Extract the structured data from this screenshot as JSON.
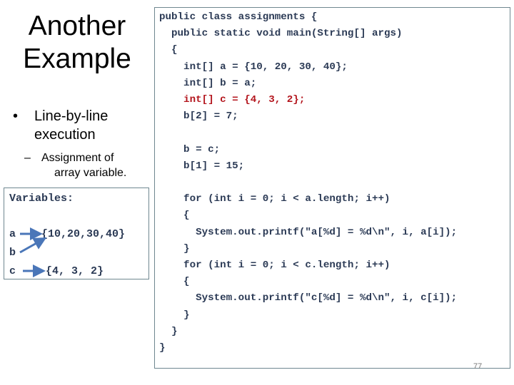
{
  "slide": {
    "title": "Another Example",
    "title_lines": [
      "Another",
      "Example"
    ],
    "bullet": "Line-by-line execution",
    "bullet_glyph": "•",
    "sub_bullet_lines": [
      "Assignment of",
      "array variable."
    ],
    "sub_bullet_glyph": "–",
    "page_number": "77"
  },
  "variables": {
    "heading": "Variables:",
    "rows": [
      {
        "name": "a",
        "value": "{10,20,30,40}"
      },
      {
        "name": "b",
        "value": ""
      },
      {
        "name": "c",
        "value": "{4, 3, 2}"
      }
    ],
    "arrow_color": "#4a76b8",
    "arrow_icon": "arrow-right-icon"
  },
  "code": {
    "highlight_color": "#b3141c",
    "text_color": "#2b3a55",
    "lines": [
      {
        "text": "public class assignments {",
        "highlight": false
      },
      {
        "text": "  public static void main(String[] args)",
        "highlight": false
      },
      {
        "text": "  {",
        "highlight": false
      },
      {
        "text": "    int[] a = {10, 20, 30, 40};",
        "highlight": false
      },
      {
        "text": "    int[] b = a;",
        "highlight": false
      },
      {
        "text": "    int[] c = {4, 3, 2};",
        "highlight": true
      },
      {
        "text": "    b[2] = 7;",
        "highlight": false
      },
      {
        "text": "",
        "highlight": false
      },
      {
        "text": "    b = c;",
        "highlight": false
      },
      {
        "text": "    b[1] = 15;",
        "highlight": false
      },
      {
        "text": "",
        "highlight": false
      },
      {
        "text": "    for (int i = 0; i < a.length; i++)",
        "highlight": false
      },
      {
        "text": "    {",
        "highlight": false
      },
      {
        "text": "      System.out.printf(\"a[%d] = %d\\n\", i, a[i]);",
        "highlight": false
      },
      {
        "text": "    }",
        "highlight": false
      },
      {
        "text": "    for (int i = 0; i < c.length; i++)",
        "highlight": false
      },
      {
        "text": "    {",
        "highlight": false
      },
      {
        "text": "      System.out.printf(\"c[%d] = %d\\n\", i, c[i]);",
        "highlight": false
      },
      {
        "text": "    }",
        "highlight": false
      },
      {
        "text": "  }",
        "highlight": false
      },
      {
        "text": "}",
        "highlight": false
      }
    ]
  }
}
